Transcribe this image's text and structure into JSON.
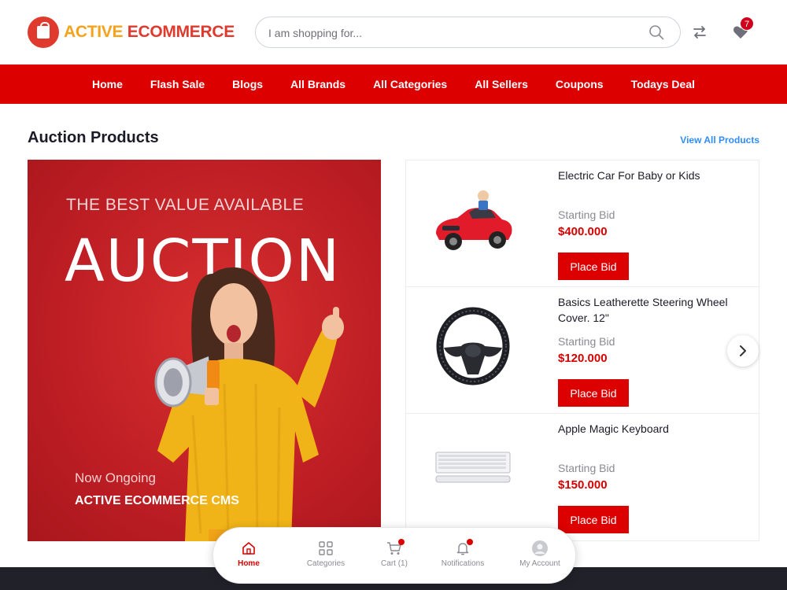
{
  "header": {
    "logo_word1": "ACTIVE",
    "logo_word2": "ECOMMERCE",
    "search_placeholder": "I am shopping for...",
    "wishlist_count": "7"
  },
  "nav": [
    "Home",
    "Flash Sale",
    "Blogs",
    "All Brands",
    "All Categories",
    "All Sellers",
    "Coupons",
    "Todays Deal"
  ],
  "section": {
    "title": "Auction Products",
    "view_all": "View All Products"
  },
  "banner": {
    "tag": "THE BEST VALUE AVAILABLE",
    "headline": "AUCTION",
    "status": "Now Ongoing",
    "brand": "ACTIVE ECOMMERCE CMS"
  },
  "products": [
    {
      "name": "Electric Car For Baby or Kids",
      "label": "Starting Bid",
      "price": "$400.000",
      "button": "Place Bid",
      "image": "red-toy-car"
    },
    {
      "name": "Basics Leatherette Steering Wheel Cover. 12\"",
      "label": "Starting Bid",
      "price": "$120.000",
      "button": "Place Bid",
      "image": "steering-wheel-cover"
    },
    {
      "name": "Apple Magic Keyboard",
      "label": "Starting Bid",
      "price": "$150.000",
      "button": "Place Bid",
      "image": "white-keyboard"
    }
  ],
  "bottom_nav": {
    "home": "Home",
    "categories": "Categories",
    "cart": "Cart (1)",
    "notifications": "Notifications",
    "account": "My Account"
  },
  "colors": {
    "brand_red": "#dc0000",
    "logo_orange": "#f6a21a",
    "link_blue": "#2f8df5"
  }
}
